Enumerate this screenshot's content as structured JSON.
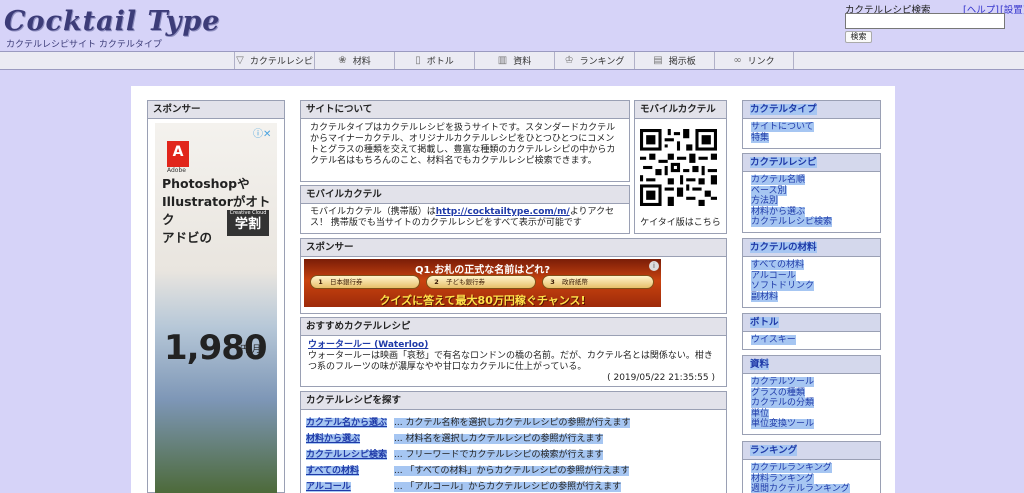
{
  "header": {
    "logo": "Cocktail Type",
    "logo_sub": "カクテルレシピサイト カクテルタイプ",
    "search_label": "カクテルレシピ検索",
    "help": "[ヘルプ]",
    "settings": "[設置]",
    "search_placeholder": "",
    "search_button": "検索"
  },
  "nav": [
    {
      "label": "カクテルレシピ",
      "icon": "glass-icon"
    },
    {
      "label": "材料",
      "icon": "ingredient-icon"
    },
    {
      "label": "ボトル",
      "icon": "bottle-icon"
    },
    {
      "label": "資料",
      "icon": "book-icon"
    },
    {
      "label": "ランキング",
      "icon": "crown-icon"
    },
    {
      "label": "掲示板",
      "icon": "board-icon"
    },
    {
      "label": "リンク",
      "icon": "link-icon"
    }
  ],
  "sponsor_left": {
    "title": "スポンサー",
    "ad": {
      "brand": "Adobe",
      "headline": "Photoshopや Illustratorがオトク アドビの",
      "line1": "Photoshopや",
      "line2": "Illustratorがオトク",
      "line3": "アドビの",
      "badge_top": "Creative Cloud",
      "badge_main": "学割",
      "price": "1,980",
      "price_unit": "円/月"
    }
  },
  "about": {
    "title": "サイトについて",
    "text": "カクテルタイプはカクテルレシピを扱うサイトです。スタンダードカクテルからマイナーカクテル、オリジナルカクテルレシピをひとつひとつにコメントとグラスの種類を交えて掲載し、豊富な種類のカクテルレシピの中からカクテル名はもちろんのこと、材料名でもカクテルレシピ検索できます。"
  },
  "mobile_left": {
    "title": "モバイルカクテル",
    "text_before": "モバイルカクテル（携帯版）は",
    "url": "http://cocktailtype.com/m/",
    "text_after": "よりアクセス！ 携帯版でも当サイトのカクテルレシピをすべて表示が可能です"
  },
  "mobile_right": {
    "title": "モバイルカクテル",
    "caption": "ケイタイ版はこちら"
  },
  "sponsor_mid": {
    "title": "スポンサー",
    "ad": {
      "question": "Q1.お札の正式な名前はどれ?",
      "options": [
        {
          "num": "1",
          "text": "日本銀行券"
        },
        {
          "num": "2",
          "text": "子ども銀行券"
        },
        {
          "num": "3",
          "text": "政府紙幣"
        }
      ],
      "banner": "クイズに答えて最大80万円稼ぐチャンス!"
    }
  },
  "recommend": {
    "title": "おすすめカクテルレシピ",
    "name": "ウォータールー (Waterloo)",
    "text": "ウォータールーは映画「哀愁」で有名なロンドンの橋の名前。だが、カクテル名とは関係ない。柑きつ系のフルーツの味が濃厚なやや甘口なカクテルに仕上がっている。",
    "date": "( 2019/05/22 21:35:55 )"
  },
  "find": {
    "title": "カクテルレシピを探す",
    "rows": [
      {
        "key": "カクテル名から選ぶ",
        "desc": "... カクテル名称を選択しカクテルレシピの参照が行えます"
      },
      {
        "key": "材料から選ぶ",
        "desc": "... 材料名を選択しカクテルレシピの参照が行えます"
      },
      {
        "key": "カクテルレシピ検索",
        "desc": "... フリーワードでカクテルレシピの検索が行えます"
      },
      {
        "key": "すべての材料",
        "desc": "... 「すべての材料」からカクテルレシピの参照が行えます"
      },
      {
        "key": "アルコール",
        "desc": "... 「アルコール」からカクテルレシピの参照が行えます"
      }
    ]
  },
  "sidebar": [
    {
      "title": "カクテルタイプ",
      "items": [
        "サイトについて",
        "特集"
      ]
    },
    {
      "title": "カクテルレシピ",
      "items": [
        "カクテル名順",
        "ベース別",
        "方法別",
        "材料から選ぶ",
        "カクテルレシピ検索"
      ]
    },
    {
      "title": "カクテルの材料",
      "items": [
        "すべての材料",
        "アルコール",
        "ソフトドリンク",
        "副材料"
      ]
    },
    {
      "title": "ボトル",
      "items": [
        "ウイスキー"
      ]
    },
    {
      "title": "資料",
      "items": [
        "カクテルツール",
        "グラスの種類",
        "カクテルの分類",
        "単位",
        "単位変換ツール"
      ]
    },
    {
      "title": "ランキング",
      "items": [
        "カクテルランキング",
        "材料ランキング",
        "週間カクテルランキング"
      ]
    }
  ],
  "colors": {
    "page_bg": "#d6d3f8",
    "link": "#1f3aa8",
    "highlight": "#a6c6f2",
    "box_border": "#9aa0b4"
  }
}
